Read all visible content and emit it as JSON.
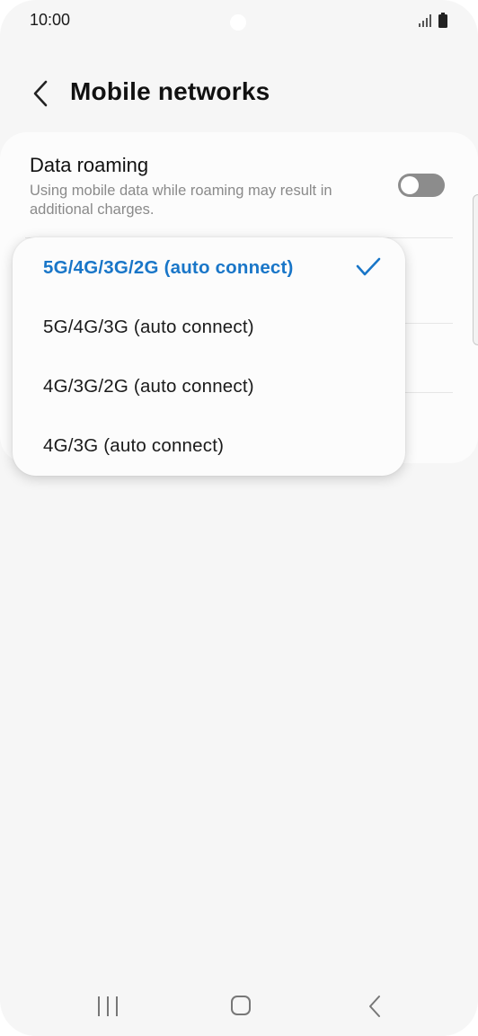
{
  "status_bar": {
    "time": "10:00",
    "icons": [
      "signal-icon",
      "battery-icon"
    ]
  },
  "header": {
    "back_icon": "chevron-left-icon",
    "title": "Mobile networks"
  },
  "settings": {
    "data_roaming": {
      "title": "Data roaming",
      "subtitle": "Using mobile data while roaming may result in additional charges.",
      "toggle_on": false
    }
  },
  "network_mode_menu": {
    "options": [
      {
        "label": "5G/4G/3G/2G (auto connect)",
        "selected": true
      },
      {
        "label": "5G/4G/3G (auto connect)",
        "selected": false
      },
      {
        "label": "4G/3G/2G (auto connect)",
        "selected": false
      },
      {
        "label": "4G/3G (auto connect)",
        "selected": false
      }
    ],
    "check_icon": "checkmark-icon"
  },
  "nav_bar": {
    "icons": [
      "recent-apps-icon",
      "home-icon",
      "back-icon"
    ]
  },
  "colors": {
    "accent": "#1976c8",
    "background": "#f6f6f6",
    "card": "#fcfcfc",
    "toggle_off": "#8c8c8c"
  }
}
